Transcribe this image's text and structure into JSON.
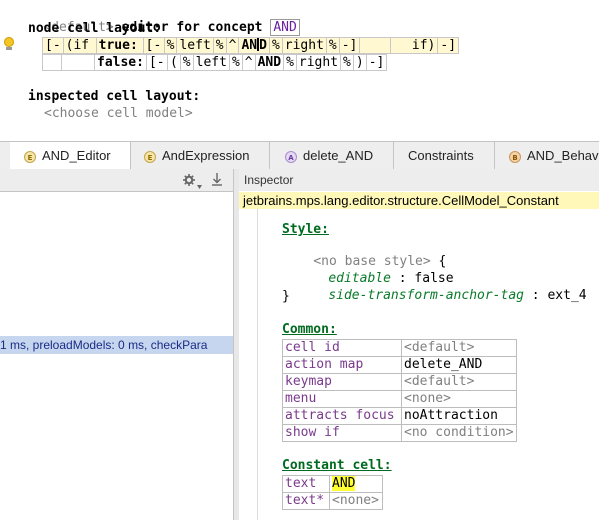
{
  "editor": {
    "header": {
      "default_tag": "<default>",
      "text": " editor for concept ",
      "concept": "AND"
    },
    "node_cell_layout_label": "node cell layout:",
    "true_row": [
      "[-",
      "(if",
      "true:",
      "[-",
      "%",
      "left",
      "%",
      "^",
      "AND",
      "%",
      "right",
      "%",
      "-]",
      "",
      "if)",
      "-]"
    ],
    "false_row": [
      "",
      "",
      "false:",
      "[-",
      "(",
      "%",
      "left",
      "%",
      "^",
      "AND",
      "%",
      "right",
      "%",
      ")",
      "-]"
    ],
    "inspected_label": "inspected cell layout:",
    "choose_model": "<choose cell model>"
  },
  "tabs": [
    {
      "label": "AND_Editor",
      "icon": "editor-icon",
      "letter": "E"
    },
    {
      "label": "AndExpression",
      "icon": "editor-icon",
      "letter": "E"
    },
    {
      "label": "delete_AND",
      "icon": "action-icon",
      "letter": "A"
    },
    {
      "label": "Constraints",
      "icon": "",
      "letter": ""
    },
    {
      "label": "AND_Behav",
      "icon": "behavior-icon",
      "letter": "B"
    }
  ],
  "left_panel": {
    "status_text": "1 ms, preloadModels: 0 ms, checkPara"
  },
  "inspector": {
    "title": "Inspector",
    "path": "jetbrains.mps.lang.editor.structure.CellModel_Constant",
    "style_label": "Style:",
    "no_base_style": "<no base style>",
    "brace_open": " {",
    "brace_close": "}",
    "style_props": [
      {
        "key": "editable",
        "sep": " : ",
        "value": "false"
      },
      {
        "key": "side-transform-anchor-tag",
        "sep": " : ",
        "value": "ext_4"
      }
    ],
    "common_label": "Common:",
    "common_rows": [
      {
        "key": "cell id",
        "value": "<default>",
        "default": true
      },
      {
        "key": "action map",
        "value": "delete_AND",
        "default": false
      },
      {
        "key": "keymap",
        "value": "<default>",
        "default": true
      },
      {
        "key": "menu",
        "value": "<none>",
        "default": true
      },
      {
        "key": "attracts focus",
        "value": "noAttraction",
        "default": false
      },
      {
        "key": "show if",
        "value": "<no condition>",
        "default": true
      }
    ],
    "constant_label": "Constant cell:",
    "constant_rows": [
      {
        "key": "text",
        "value": "AND",
        "default": false
      },
      {
        "key": "text*",
        "value": "<none>",
        "default": true
      }
    ]
  },
  "colors": {
    "keyword": "#000000",
    "concept": "#6a1fa0",
    "section": "#006b1f",
    "status_bg": "#c5d6ee",
    "path_bg": "#fff8b8",
    "highlight": "#ffff33"
  }
}
